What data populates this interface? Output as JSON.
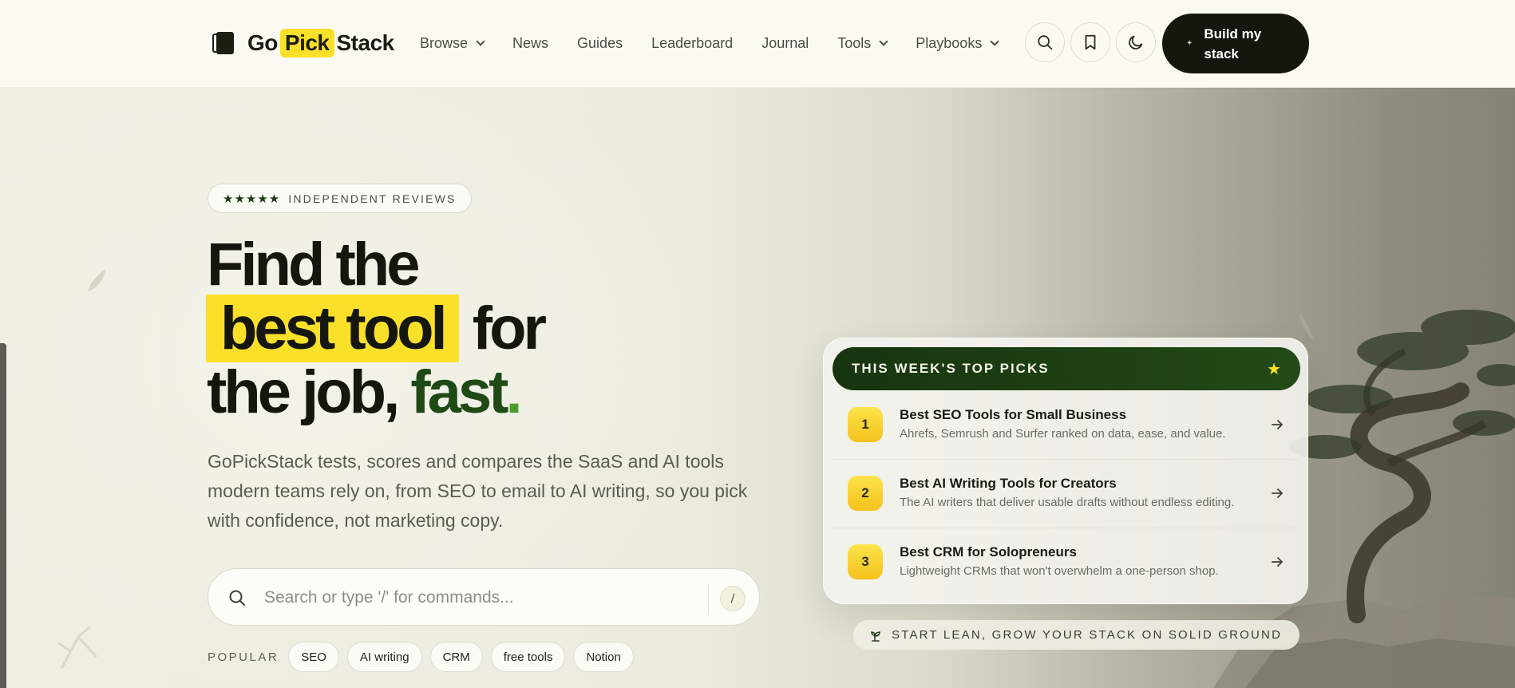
{
  "brand": {
    "part1": "Go",
    "part2": "Pick",
    "part3": "Stack"
  },
  "nav": [
    {
      "label": "Browse",
      "dropdown": true
    },
    {
      "label": "News",
      "dropdown": false
    },
    {
      "label": "Guides",
      "dropdown": false
    },
    {
      "label": "Leaderboard",
      "dropdown": false
    },
    {
      "label": "Journal",
      "dropdown": false
    },
    {
      "label": "Tools",
      "dropdown": true
    },
    {
      "label": "Playbooks",
      "dropdown": true
    }
  ],
  "header_icons": [
    "search-icon",
    "bookmark-icon",
    "moon-icon"
  ],
  "cta": {
    "label": "Build my stack",
    "icon": "sparkle-icon"
  },
  "hero": {
    "badge": {
      "stars": "★★★★★",
      "text": "INDEPENDENT REVIEWS"
    },
    "headline": {
      "line1": "Find the",
      "highlight": "best tool",
      "line2_rest": "for",
      "line3_start": "the job,",
      "line3_accent": "fast",
      "line3_dot": "."
    },
    "lead": "GoPickStack tests, scores and compares the SaaS and AI tools modern teams rely on, from SEO to email to AI writing, so you pick with confidence, not marketing copy.",
    "search": {
      "placeholder": "Search or type '/' for commands...",
      "shortcut": "/"
    },
    "popular": {
      "label": "POPULAR",
      "tags": [
        "SEO",
        "AI writing",
        "CRM",
        "free tools",
        "Notion"
      ]
    }
  },
  "top_picks": {
    "title": "THIS WEEK'S TOP PICKS",
    "items": [
      {
        "rank": "1",
        "title": "Best SEO Tools for Small Business",
        "desc": "Ahrefs, Semrush and Surfer ranked on data, ease, and value."
      },
      {
        "rank": "2",
        "title": "Best AI Writing Tools for Creators",
        "desc": "The AI writers that deliver usable drafts without endless editing."
      },
      {
        "rank": "3",
        "title": "Best CRM for Solopreneurs",
        "desc": "Lightweight CRMs that won't overwhelm a one-person shop."
      }
    ]
  },
  "tagline": "START LEAN, GROW YOUR STACK ON SOLID GROUND",
  "colors": {
    "accent_yellow": "#fbe02a",
    "brand_green": "#1f4a16",
    "dark": "#15170f"
  }
}
